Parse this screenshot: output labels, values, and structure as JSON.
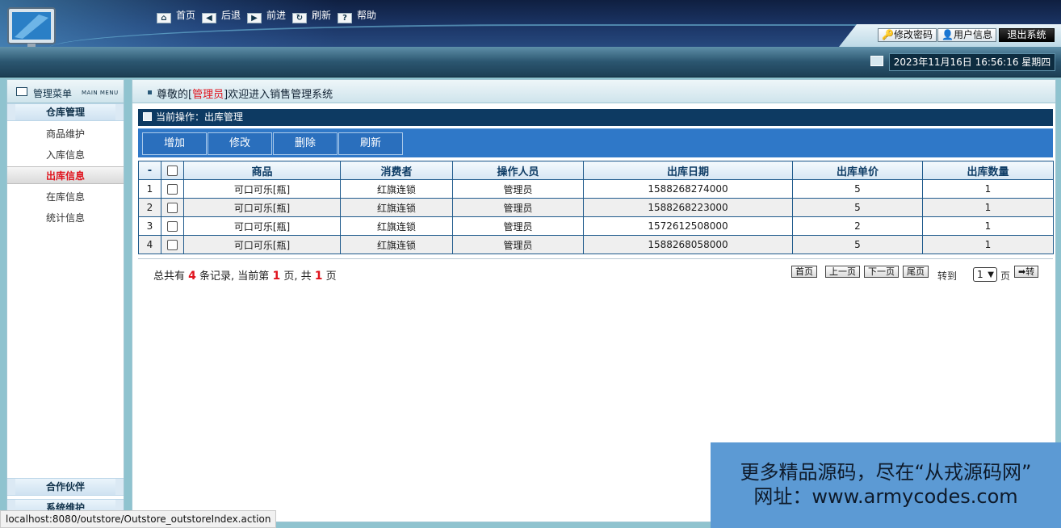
{
  "header": {
    "buttons": [
      "修改密码",
      "用户信息",
      "退出系统"
    ]
  },
  "nav": {
    "items": [
      {
        "label": "首页",
        "icon": "home-icon"
      },
      {
        "label": "后退",
        "icon": "back-arrow-icon"
      },
      {
        "label": "前进",
        "icon": "forward-arrow-icon"
      },
      {
        "label": "刷新",
        "icon": "refresh-icon"
      },
      {
        "label": "帮助",
        "icon": "help-icon"
      }
    ],
    "datetime": "2023年11月16日 16:56:16 星期四"
  },
  "sidebar": {
    "title": "管理菜单",
    "subtitle": "MAIN MENU",
    "group1": "仓库管理",
    "items": [
      "商品维护",
      "入库信息",
      "出库信息",
      "在库信息",
      "统计信息"
    ],
    "active_item": "出库信息",
    "group2": "合作伙伴",
    "group3": "系统维护"
  },
  "welcome": {
    "prefix": "尊敬的[",
    "role": "管理员",
    "suffix": "]欢迎进入销售管理系统"
  },
  "operation": {
    "label": "当前操作：出库管理"
  },
  "toolbar": {
    "buttons": [
      "增加",
      "修改",
      "删除",
      "刷新"
    ]
  },
  "table": {
    "columns": [
      "-",
      "",
      "商品",
      "消费者",
      "操作人员",
      "出库日期",
      "出库单价",
      "出库数量"
    ],
    "rows": [
      [
        "1",
        "可口可乐[瓶]",
        "红旗连锁",
        "管理员",
        "1588268274000",
        "5",
        "1"
      ],
      [
        "2",
        "可口可乐[瓶]",
        "红旗连锁",
        "管理员",
        "1588268223000",
        "5",
        "1"
      ],
      [
        "3",
        "可口可乐[瓶]",
        "红旗连锁",
        "管理员",
        "1572612508000",
        "2",
        "1"
      ],
      [
        "4",
        "可口可乐[瓶]",
        "红旗连锁",
        "管理员",
        "1588268058000",
        "5",
        "1"
      ]
    ]
  },
  "pager": {
    "t1": "总共有",
    "total": "4",
    "t2": "条记录, 当前第",
    "current": "1",
    "t3": "页, 共",
    "pages": "1",
    "t4": "页",
    "first": "首页",
    "prev": "上一页",
    "next": "下一页",
    "last": "尾页",
    "goto": "转到",
    "selected": "1",
    "unit": "页",
    "go": "➡转"
  },
  "watermark": {
    "line1": "更多精品源码，尽在“从戎源码网”",
    "line2": "网址：www.armycodes.com"
  },
  "statusbar": {
    "url": "localhost:8080/outstore/Outstore_outstoreIndex.action"
  }
}
